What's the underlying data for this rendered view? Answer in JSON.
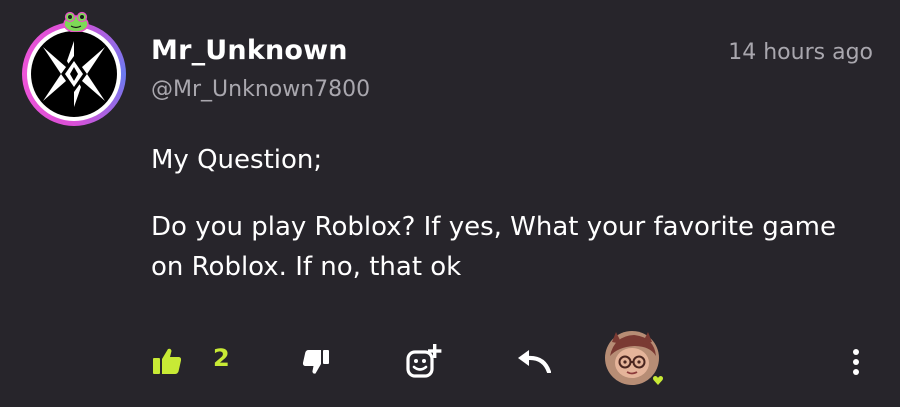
{
  "post": {
    "author": {
      "display_name": "Mr_Unknown",
      "handle": "@Mr_Unknown7800",
      "avatar_icon": "diamond-star-emblem-icon"
    },
    "timestamp": "14 hours ago",
    "body": {
      "heading": "My Question;",
      "text": "Do you play Roblox? If yes, What your favorite game on Roblox. If no, that ok"
    }
  },
  "actions": {
    "like_icon": "thumbs-up-icon",
    "like_count": "2",
    "dislike_icon": "thumbs-down-icon",
    "react_icon": "add-reaction-icon",
    "reply_icon": "reply-arrow-icon",
    "replier_avatar_icon": "user-avatar-icon",
    "more_icon": "more-vertical-icon"
  },
  "colors": {
    "background": "#27252b",
    "accent": "#c8ea35",
    "muted_text": "#a9a7ae",
    "avatar_ring": "#d94fd6"
  }
}
